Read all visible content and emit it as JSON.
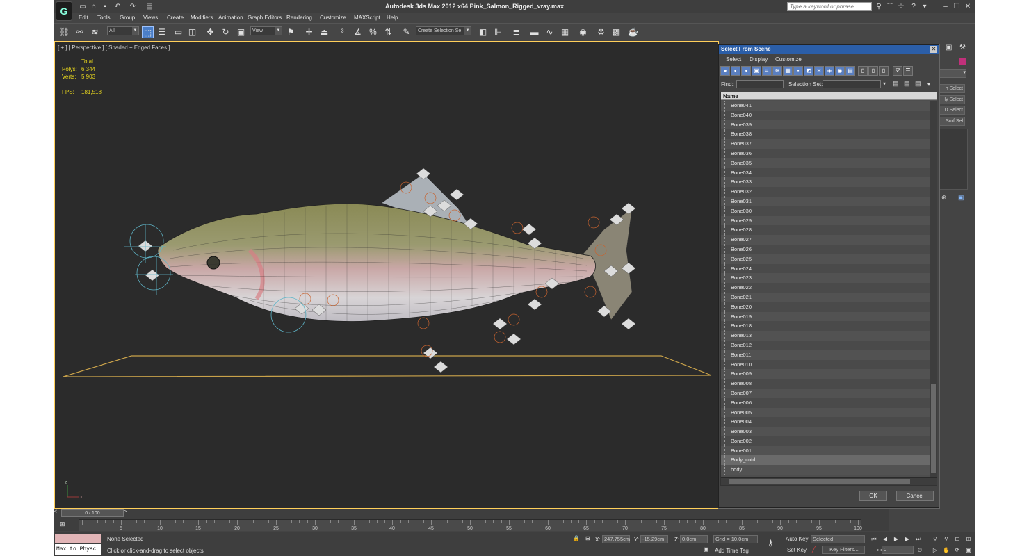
{
  "window": {
    "title": "Autodesk 3ds Max  2012 x64     Pink_Salmon_Rigged_vray.max",
    "search_placeholder": "Type a keyword or phrase",
    "logo": "G"
  },
  "menus": [
    "Edit",
    "Tools",
    "Group",
    "Views",
    "Create",
    "Modifiers",
    "Animation",
    "Graph Editors",
    "Rendering",
    "Customize",
    "MAXScript",
    "Help"
  ],
  "toolbar": {
    "filter_value": "All",
    "ref_coord_value": "View",
    "selection_set_value": "Create Selection Se"
  },
  "viewport": {
    "label": "[ + ] [ Perspective ] [ Shaded + Edged Faces ]",
    "stats": {
      "total_label": "Total",
      "polys_label": "Polys:",
      "polys_value": "6 344",
      "verts_label": "Verts:",
      "verts_value": "5 903",
      "fps_label": "FPS:",
      "fps_value": "181,518"
    }
  },
  "dialog": {
    "title": "Select From Scene",
    "menu": [
      "Select",
      "Display",
      "Customize"
    ],
    "find_label": "Find:",
    "selection_set_label": "Selection Set:",
    "column_name": "Name",
    "items": [
      "Bone041",
      "Bone040",
      "Bone039",
      "Bone038",
      "Bone037",
      "Bone036",
      "Bone035",
      "Bone034",
      "Bone033",
      "Bone032",
      "Bone031",
      "Bone030",
      "Bone029",
      "Bone028",
      "Bone027",
      "Bone026",
      "Bone025",
      "Bone024",
      "Bone023",
      "Bone022",
      "Bone021",
      "Bone020",
      "Bone019",
      "Bone018",
      "Bone013",
      "Bone012",
      "Bone011",
      "Bone010",
      "Bone009",
      "Bone008",
      "Bone007",
      "Bone006",
      "Bone005",
      "Bone004",
      "Bone003",
      "Bone002",
      "Bone001",
      "Body_cntrl",
      "body"
    ],
    "ok_label": "OK",
    "cancel_label": "Cancel"
  },
  "command_panel": {
    "buttons": [
      "h Select",
      "ly Select",
      "D Select",
      "Surf Sel"
    ]
  },
  "timeline": {
    "frame_label": "0 / 100",
    "ticks": [
      "5",
      "10",
      "15",
      "20",
      "25",
      "30",
      "35",
      "40",
      "45",
      "50",
      "55",
      "60",
      "65",
      "70",
      "75",
      "80",
      "85",
      "90",
      "95",
      "100"
    ]
  },
  "status": {
    "maxscript": "Max to Physc",
    "selection": "None Selected",
    "prompt": "Click or click-and-drag to select objects",
    "x_label": "X:",
    "x_value": "247,755cm",
    "y_label": "Y:",
    "y_value": "-15,29cm",
    "z_label": "Z:",
    "z_value": "0,0cm",
    "grid": "Grid = 10,0cm",
    "add_time_tag": "Add Time Tag",
    "auto_key": "Auto Key",
    "set_key": "Set Key",
    "key_mode_value": "Selected",
    "key_filters": "Key Filters...",
    "frame_value": "0"
  },
  "colors": {
    "stats": "#e7d51e",
    "viewport_bg": "#2b2b2b",
    "dialog_title": "#2b5ea8",
    "ground": "#c9a24a"
  }
}
